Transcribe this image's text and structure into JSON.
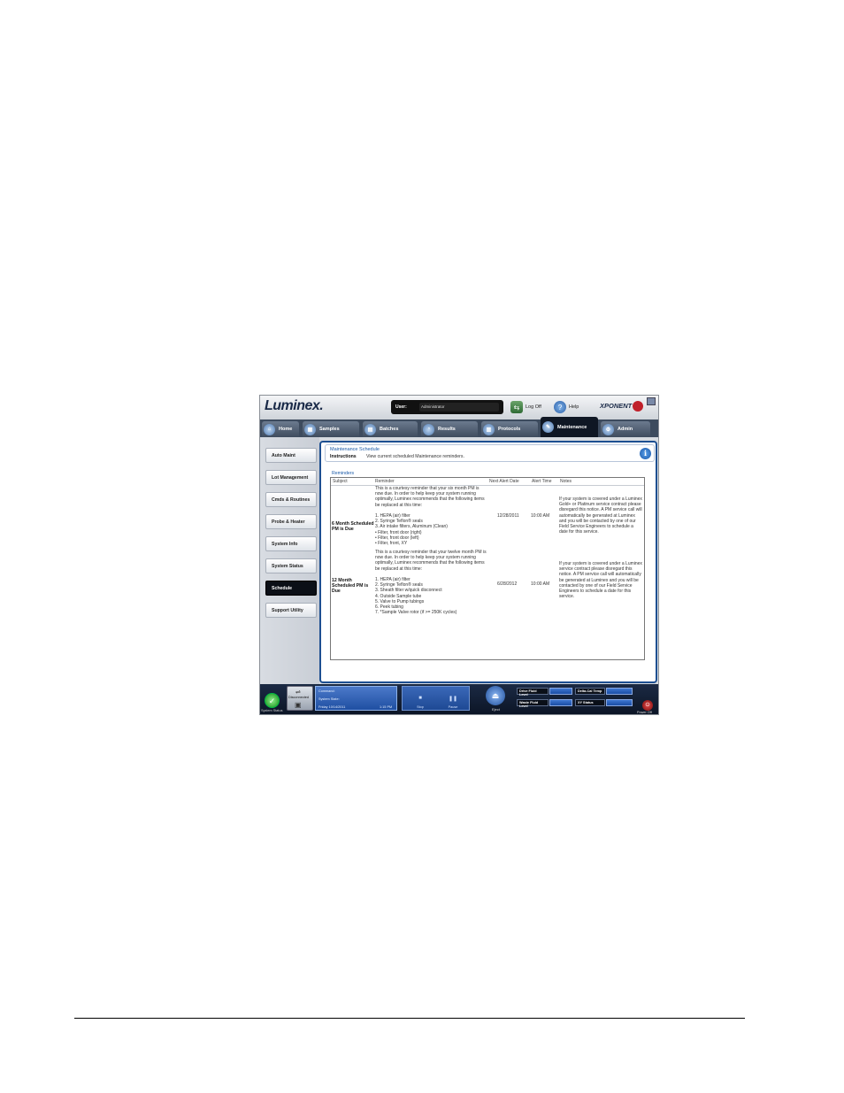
{
  "header": {
    "logo": "Luminex.",
    "user_label": "User:",
    "user_value": "Administrator",
    "logoff_label": "Log Off",
    "help_label": "Help",
    "product_logo": "XPONENT"
  },
  "tabs": [
    {
      "label": "Home",
      "icon": "home-icon"
    },
    {
      "label": "Samples",
      "icon": "samples-icon"
    },
    {
      "label": "Batches",
      "icon": "batches-icon"
    },
    {
      "label": "Results",
      "icon": "results-icon"
    },
    {
      "label": "Protocols",
      "icon": "protocols-icon"
    },
    {
      "label": "Maintenance",
      "icon": "maintenance-icon",
      "active": true
    },
    {
      "label": "Admin",
      "icon": "admin-icon"
    }
  ],
  "sidebar": {
    "items": [
      {
        "label": "Auto Maint"
      },
      {
        "label": "Lot Management"
      },
      {
        "label": "Cmds & Routines"
      },
      {
        "label": "Probe & Heater"
      },
      {
        "label": "System Info"
      },
      {
        "label": "System Status"
      },
      {
        "label": "Schedule",
        "active": true
      },
      {
        "label": "Support Utility"
      }
    ]
  },
  "main": {
    "title": "Maintenance Schedule",
    "instructions_label": "Instructions",
    "instructions_text": "View current scheduled Maintenance reminders.",
    "reminders_label": "Reminders",
    "columns": [
      "Subject",
      "Reminder",
      "Next Alert Date",
      "Alert Time",
      "Notes"
    ],
    "rows": [
      {
        "subject": "6 Month Scheduled PM is Due",
        "reminder_intro": "This is a courtesy reminder that your six month PM is now due. In order to help keep your system running optimally, Luminex recommends that the following items be replaced at this time:",
        "steps": [
          "1.      HEPA (air) filter",
          "2.      Syringe Teflon® seals",
          "3.      Air intake filters, Aluminum (Clean)",
          "        • Filter, front door (right)",
          "        • Filter, front door (left)",
          "        • Filter, front, XY"
        ],
        "next_alert_date": "12/28/2011",
        "alert_time": "10:00 AM",
        "notes": "If your system is covered under a Luminex Gold+ or Platinum service contract please disregard this notice. A PM service call will automatically be generated at Luminex and you will be contacted by one of our Field Service Engineers to schedule a date for this service."
      },
      {
        "subject": "12 Month Scheduled PM is Due",
        "reminder_intro": "This is a courtesy reminder that your twelve month PM is now due. In order to help keep your system running optimally, Luminex recommends that the following items be replaced at this time:",
        "steps": [
          "1.      HEPA (air) filter",
          "2.      Syringe Teflon® seals",
          "3.      Sheath filter w/quick disconnect",
          "4.      Outside Sample tube",
          "5.      Valve to Pump tubings",
          "6.      Peek tubing",
          "7.      *Sample Valve rotor (if >= 250K cycles)"
        ],
        "next_alert_date": "6/28/2012",
        "alert_time": "10:00 AM",
        "notes": "If your system is covered under a Luminex service contract please disregard this notice. A PM service call will automatically be generated at Luminex and you will be contacted by one of our Field Service Engineers to schedule a date for this service."
      }
    ]
  },
  "bottombar": {
    "system_status_label": "System Status",
    "disconnected_label": "Disconnected",
    "command_label": "Command:",
    "system_state_label": "System State:",
    "date": "Friday 10/14/2011",
    "time": "1:15 PM",
    "stop_label": "Stop",
    "pause_label": "Pause",
    "eject_label": "Eject",
    "drive_fluid_label": "Drive Fluid Level",
    "waste_fluid_label": "Waste Fluid Level",
    "delta_cal_label": "Delta-Cal Temp",
    "xy_status_label": "XY Status",
    "power_off_label": "Power Off"
  }
}
